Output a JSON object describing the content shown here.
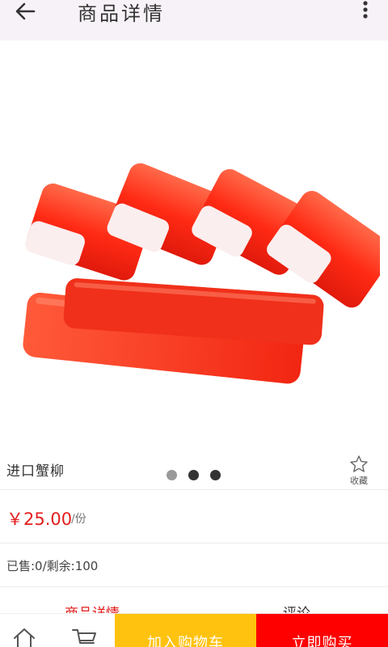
{
  "header": {
    "title": "商品详情",
    "back_icon": "arrow-left-icon",
    "more_icon": "more-vertical-icon"
  },
  "gallery": {
    "image_subject": "crab-sticks-photo",
    "dot_count": 3,
    "active_dot": 0
  },
  "product": {
    "name": "进口蟹柳",
    "favorite_label": "收藏",
    "price": "￥25.00",
    "unit": "/份",
    "stock": "已售:0/剩余:100"
  },
  "tabs": {
    "detail": "商品详情",
    "comments": "评论"
  },
  "bottom_bar": {
    "add_to_cart": "加入购物车",
    "buy_now": "立即购买",
    "home_icon": "home-icon",
    "cart_icon": "cart-icon"
  },
  "colors": {
    "accent_red": "#e31d1d",
    "cart_yellow": "#ffc20e",
    "buy_red": "#ff0000",
    "header_bg": "#f7f2f7"
  }
}
